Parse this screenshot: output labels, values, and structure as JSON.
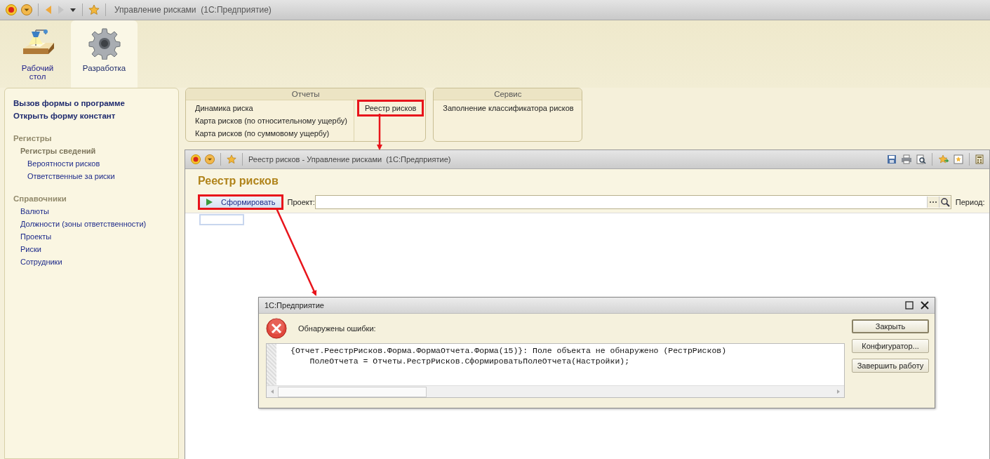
{
  "window": {
    "title": "Управление рисками  (1С:Предприятие)"
  },
  "sections": [
    {
      "label": "Рабочий стол",
      "kind": "desk",
      "selected": false
    },
    {
      "label": "Разработка",
      "kind": "gear",
      "selected": true
    }
  ],
  "sidebar": {
    "commands": [
      "Вызов формы о программе",
      "Открыть форму констант"
    ],
    "groups": [
      {
        "title": "Регистры",
        "items": [
          {
            "label": "Регистры сведений",
            "kind": "subgroup",
            "children": [
              {
                "label": "Вероятности рисков",
                "kind": "link"
              },
              {
                "label": "Ответственные за риски",
                "kind": "link"
              }
            ]
          }
        ]
      },
      {
        "title": "Справочники",
        "items": [
          {
            "label": "Валюты",
            "kind": "link"
          },
          {
            "label": "Должности (зоны ответственности)",
            "kind": "link"
          },
          {
            "label": "Проекты",
            "kind": "link"
          },
          {
            "label": "Риски",
            "kind": "link"
          },
          {
            "label": "Сотрудники",
            "kind": "link"
          }
        ]
      }
    ]
  },
  "panels": [
    {
      "title": "Отчеты",
      "columns": [
        [
          {
            "label": "Динамика риска",
            "highlighted": false
          },
          {
            "label": "Карта рисков (по относительному ущербу)",
            "highlighted": false
          },
          {
            "label": "Карта рисков (по суммовому ущербу)",
            "highlighted": false
          }
        ],
        [
          {
            "label": "Реестр рисков",
            "highlighted": true
          }
        ]
      ]
    },
    {
      "title": "Сервис",
      "columns": [
        [
          {
            "label": "Заполнение классификатора рисков",
            "highlighted": false
          }
        ]
      ]
    }
  ],
  "report_window": {
    "title": "Реестр рисков - Управление рисками  (1С:Предприятие)",
    "heading": "Реестр рисков",
    "generate_button": {
      "label": "Сформировать",
      "highlighted": true
    },
    "project_field": {
      "label": "Проект:"
    },
    "period_label": "Период:"
  },
  "dialog": {
    "title": "1С:Предприятие",
    "message": "Обнаружены ошибки:",
    "error_lines": [
      "{Отчет.РеестрРисков.Форма.ФормаОтчета.Форма(15)}: Поле объекта не обнаружено (РестрРисков)",
      "    ПолеОтчета = Отчеты.РестрРисков.СформироватьПолеОтчета(Настройки);"
    ],
    "buttons": [
      {
        "label": "Закрыть",
        "default": true
      },
      {
        "label": "Конфигуратор...",
        "default": false
      },
      {
        "label": "Завершить работу",
        "default": false
      }
    ]
  }
}
